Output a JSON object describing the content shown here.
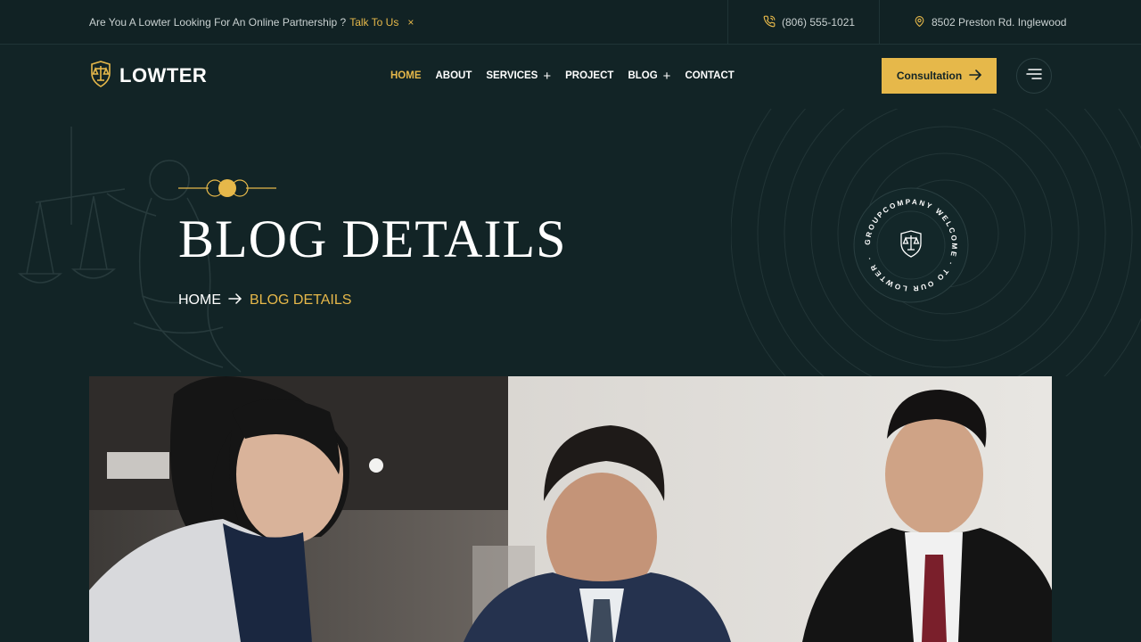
{
  "topbar": {
    "promo_text": "Are You A Lowter Looking For An Online Partnership ?",
    "promo_link": "Talk To Us",
    "close_symbol": "×",
    "phone": "(806) 555-1021",
    "address": "8502 Preston Rd. Inglewood"
  },
  "header": {
    "brand": "LOWTER",
    "nav": {
      "home": "HOME",
      "about": "ABOUT",
      "services": "SERVICES",
      "project": "PROJECT",
      "blog": "BLOG",
      "contact": "CONTACT"
    },
    "cta_label": "Consultation"
  },
  "hero": {
    "title": "BLOG DETAILS",
    "breadcrumb_home": "HOME",
    "breadcrumb_current": "BLOG DETAILS",
    "badge_text": "GROUPCOMPANY WELCOME · TO OUR LOWTER ·"
  },
  "icons": {
    "phone": "phone-icon",
    "location": "location-pin-icon",
    "logo": "shield-scales-icon",
    "arrow": "arrow-right-icon",
    "menu": "hamburger-icon"
  },
  "colors": {
    "background": "#122426",
    "accent": "#e6b84a",
    "text": "#ffffff"
  }
}
